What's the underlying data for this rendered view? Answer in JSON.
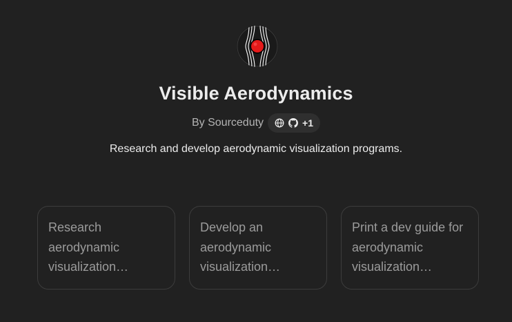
{
  "gpt": {
    "title": "Visible Aerodynamics",
    "author": "By Sourceduty",
    "link_icons": [
      "globe-icon",
      "github-icon"
    ],
    "extra_links": "+1",
    "description": "Research and develop aerodynamic visualization programs."
  },
  "prompts": [
    {
      "text": "Research aerodynamic visualization…"
    },
    {
      "text": "Develop an aerodynamic visualization…"
    },
    {
      "text": "Print a dev guide for aerodynamic visualization…"
    }
  ],
  "colors": {
    "background": "#212121",
    "text_primary": "#ececec",
    "text_secondary": "#b4b4b4",
    "card_text": "#9b9b9b",
    "card_border": "#3d3d3d",
    "pill_bg": "#2f2f2f",
    "logo_accent": "#e41a1a"
  }
}
